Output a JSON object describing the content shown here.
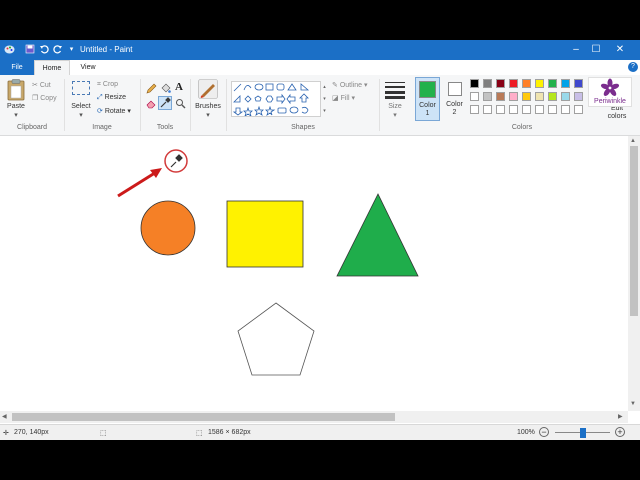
{
  "window": {
    "title": "Untitled - Paint",
    "minimize_icon": "minimize-icon",
    "maximize_icon": "maximize-icon",
    "close_icon": "close-icon"
  },
  "tabs": [
    {
      "label": "File"
    },
    {
      "label": "Home"
    },
    {
      "label": "View"
    }
  ],
  "clipboard": {
    "paste": "Paste",
    "cut": "Cut",
    "copy": "Copy",
    "group_label": "Clipboard"
  },
  "image": {
    "select": "Select",
    "crop": "Crop",
    "resize": "Resize",
    "rotate": "Rotate",
    "group_label": "Image"
  },
  "tools": {
    "group_label": "Tools",
    "pencil": "pencil-icon",
    "fill": "fill-icon",
    "text": "A",
    "eraser": "eraser-icon",
    "picker": "color-picker-icon",
    "magnifier": "magnifier-icon"
  },
  "brushes": {
    "label": "Brushes"
  },
  "shapes": {
    "outline": "Outline",
    "fill": "Fill",
    "group_label": "Shapes"
  },
  "size": {
    "label": "Size"
  },
  "color1": {
    "label": "Color",
    "sub": "1",
    "color": "#22b14c"
  },
  "color2": {
    "label": "Color",
    "sub": "2",
    "color": "#ffffff"
  },
  "colors": {
    "group_label": "Colors",
    "row1": [
      "#000000",
      "#7f7f7f",
      "#880015",
      "#ed1c24",
      "#ff7f27",
      "#fff200",
      "#22b14c",
      "#00a2e8",
      "#3f48cc"
    ],
    "row2": [
      "#ffffff",
      "#c3c3c3",
      "#b97a57",
      "#ffaec9",
      "#ffc90e",
      "#efe4b0",
      "#b5e61d",
      "#99d9ea",
      "#c8bfe7"
    ],
    "row3": [
      "#ffffff",
      "#ffffff",
      "#ffffff",
      "#ffffff",
      "#ffffff",
      "#ffffff",
      "#ffffff",
      "#ffffff",
      "#ffffff"
    ]
  },
  "edit_colors": {
    "line1": "Edit",
    "line2": "colors"
  },
  "watermark": {
    "label": "Periwinkle"
  },
  "canvas": {
    "circle_color": "#f58026",
    "square_color": "#fff200",
    "triangle_color": "#1fad4b",
    "pentagon_color": "#ffffff",
    "arrow_color": "#cc1a1a"
  },
  "status": {
    "position": "270, 140px",
    "dimensions": "1586 × 682px",
    "zoom": "100%",
    "zoom_level": 0.5
  }
}
